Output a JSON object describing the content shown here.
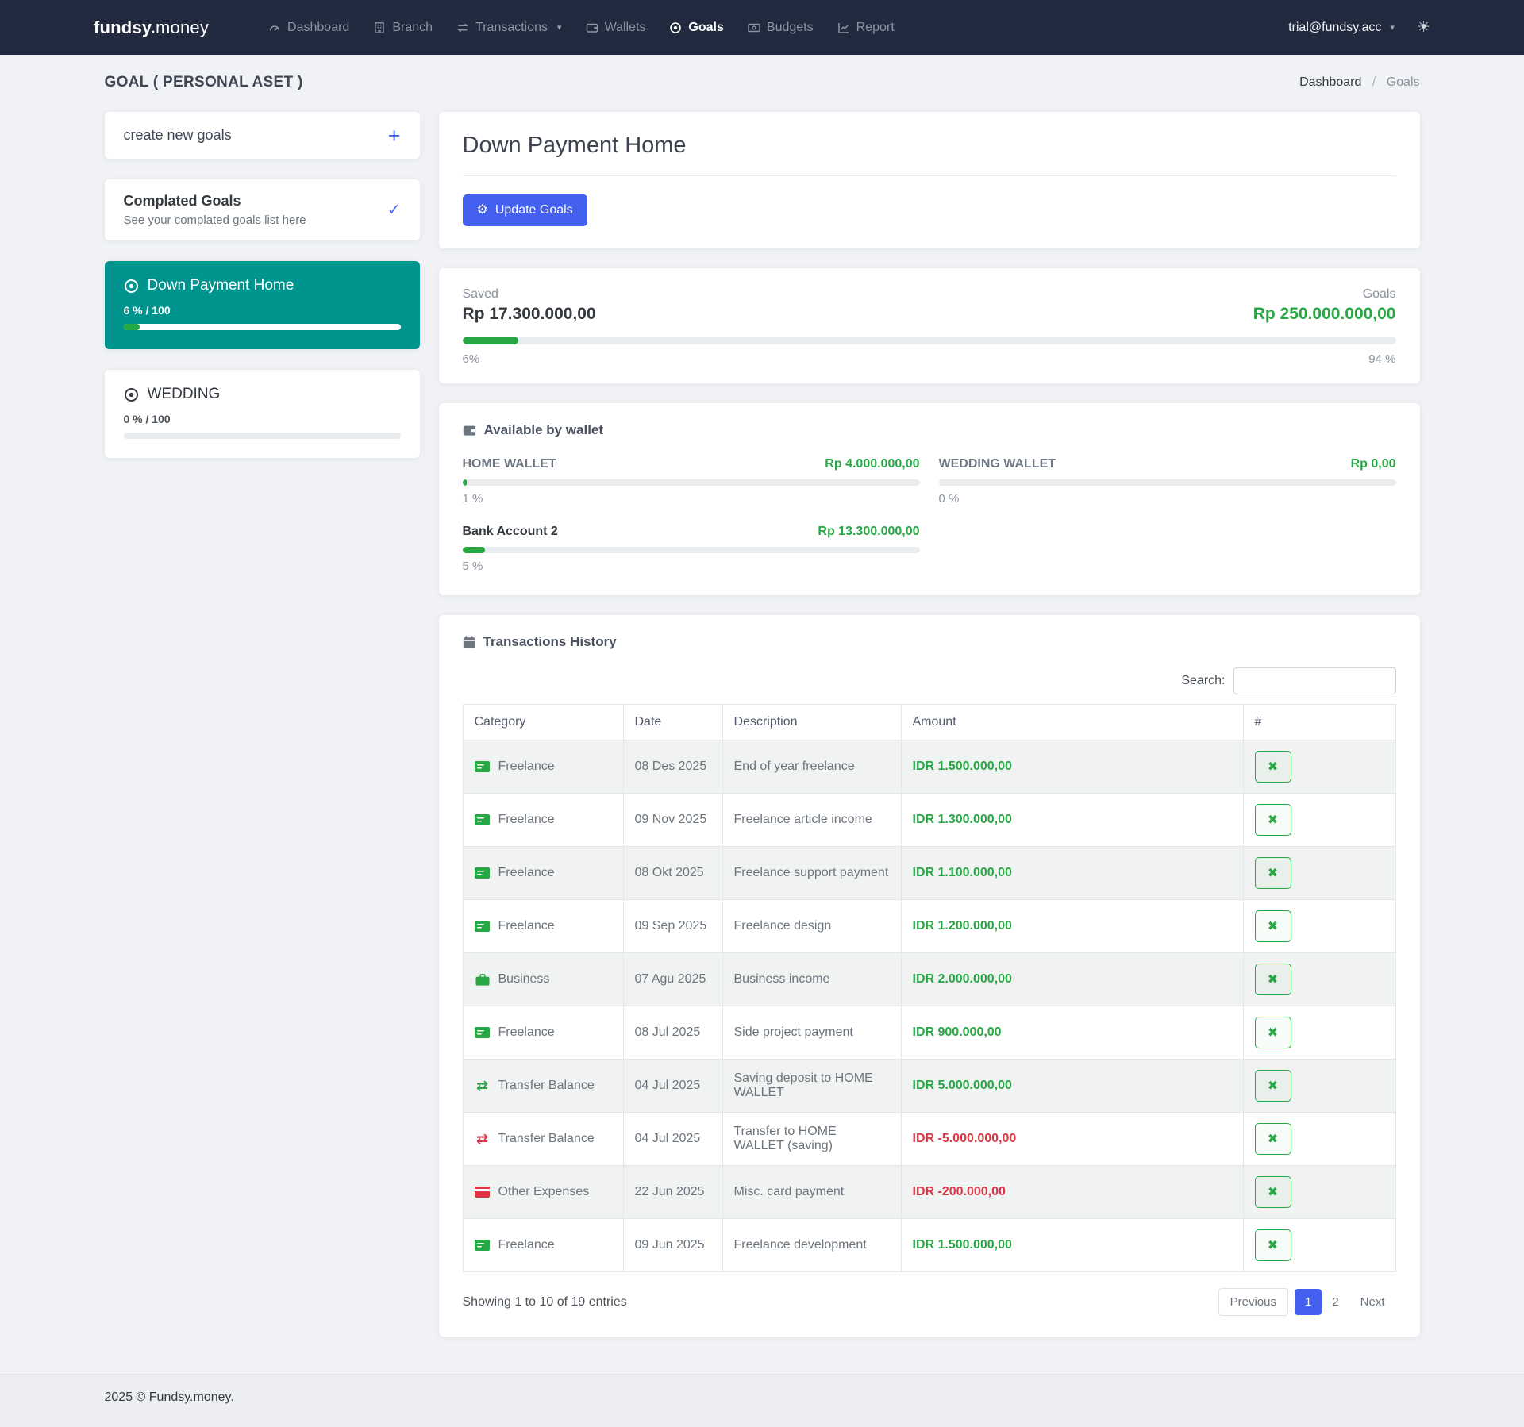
{
  "navbar": {
    "brand_bold": "fundsy.",
    "brand_rest": "money",
    "items": [
      {
        "label": "Dashboard",
        "icon": "tachometer-icon",
        "active": false
      },
      {
        "label": "Branch",
        "icon": "building-icon",
        "active": false
      },
      {
        "label": "Transactions",
        "icon": "exchange-icon",
        "active": false,
        "has_dropdown": true
      },
      {
        "label": "Wallets",
        "icon": "wallet-icon",
        "active": false
      },
      {
        "label": "Goals",
        "icon": "bullseye-icon",
        "active": true
      },
      {
        "label": "Budgets",
        "icon": "money-bill-icon",
        "active": false
      },
      {
        "label": "Report",
        "icon": "chart-line-icon",
        "active": false
      }
    ],
    "user": {
      "label": "trial@fundsy.acc",
      "caret_icon": "chevron-down-icon"
    },
    "theme_icon": "sun-icon"
  },
  "page": {
    "title": "GOAL ( PERSONAL ASET )",
    "breadcrumb": [
      "Dashboard",
      "Goals"
    ]
  },
  "sidebar": {
    "create": {
      "label": "create new goals",
      "icon": "plus-icon"
    },
    "completed": {
      "title": "Complated Goals",
      "subtitle": "See your complated goals list here",
      "icon": "check-icon"
    },
    "goals": [
      {
        "name": "Down Payment Home",
        "icon": "bullseye-icon",
        "progress_label": "6 % / 100",
        "percent": 6,
        "active": true
      },
      {
        "name": "WEDDING",
        "icon": "bullseye-icon",
        "progress_label": "0 % / 100",
        "percent": 0,
        "active": false
      }
    ]
  },
  "main": {
    "header": {
      "title": "Down Payment Home",
      "update_button": "Update Goals",
      "update_icon": "gear-icon"
    },
    "summary": {
      "saved_label": "Saved",
      "saved_value": "Rp 17.300.000,00",
      "goals_label": "Goals",
      "goals_value": "Rp 250.000.000,00",
      "percent": 6,
      "percent_left": "6%",
      "percent_right": "94 %"
    },
    "wallets": {
      "title": "Available by wallet",
      "icon": "wallet-icon",
      "items": [
        {
          "name": "HOME WALLET",
          "amount": "Rp 4.000.000,00",
          "percent": 1,
          "percent_label": "1 %"
        },
        {
          "name": "WEDDING WALLET",
          "amount": "Rp 0,00",
          "percent": 0,
          "percent_label": "0 %"
        },
        {
          "name": "Bank Account 2",
          "amount": "Rp 13.300.000,00",
          "percent": 5,
          "percent_label": "5 %"
        }
      ]
    },
    "transactions": {
      "title": "Transactions History",
      "icon": "calendar-icon",
      "search_label": "Search:",
      "search_value": "",
      "columns": [
        "Category",
        "Date",
        "Description",
        "Amount",
        "#"
      ],
      "rows": [
        {
          "category": "Freelance",
          "icon": "money-check-icon",
          "date": "08 Des 2025",
          "description": "End of year freelance",
          "amount": "IDR 1.500.000,00",
          "negative": false
        },
        {
          "category": "Freelance",
          "icon": "money-check-icon",
          "date": "09 Nov 2025",
          "description": "Freelance article income",
          "amount": "IDR 1.300.000,00",
          "negative": false
        },
        {
          "category": "Freelance",
          "icon": "money-check-icon",
          "date": "08 Okt 2025",
          "description": "Freelance support payment",
          "amount": "IDR 1.100.000,00",
          "negative": false
        },
        {
          "category": "Freelance",
          "icon": "money-check-icon",
          "date": "09 Sep 2025",
          "description": "Freelance design",
          "amount": "IDR 1.200.000,00",
          "negative": false
        },
        {
          "category": "Business",
          "icon": "briefcase-icon",
          "date": "07 Agu 2025",
          "description": "Business income",
          "amount": "IDR 2.000.000,00",
          "negative": false
        },
        {
          "category": "Freelance",
          "icon": "money-check-icon",
          "date": "08 Jul 2025",
          "description": "Side project payment",
          "amount": "IDR 900.000,00",
          "negative": false
        },
        {
          "category": "Transfer Balance",
          "icon": "exchange-icon",
          "date": "04 Jul 2025",
          "description": "Saving deposit to HOME WALLET",
          "amount": "IDR 5.000.000,00",
          "negative": false
        },
        {
          "category": "Transfer Balance",
          "icon": "exchange-icon",
          "date": "04 Jul 2025",
          "description": "Transfer to HOME WALLET (saving)",
          "amount": "IDR -5.000.000,00",
          "negative": true
        },
        {
          "category": "Other Expenses",
          "icon": "credit-card-icon",
          "date": "22 Jun 2025",
          "description": "Misc. card payment",
          "amount": "IDR -200.000,00",
          "negative": true
        },
        {
          "category": "Freelance",
          "icon": "money-check-icon",
          "date": "09 Jun 2025",
          "description": "Freelance development",
          "amount": "IDR 1.500.000,00",
          "negative": false
        }
      ],
      "row_action_icon": "x-icon",
      "showing": "Showing 1 to 10 of 19 entries",
      "pagination": {
        "previous": "Previous",
        "page1": "1",
        "page2": "2",
        "next": "Next",
        "active_page": "1"
      }
    }
  },
  "footer": {
    "text": "2025 © Fundsy.money."
  },
  "colors": {
    "navbar_bg": "#212a3e",
    "accent_blue": "#4361ee",
    "teal_active": "#00948e",
    "success_green": "#28a745",
    "danger_red": "#dc3545",
    "page_bg": "#f0f2f5"
  }
}
